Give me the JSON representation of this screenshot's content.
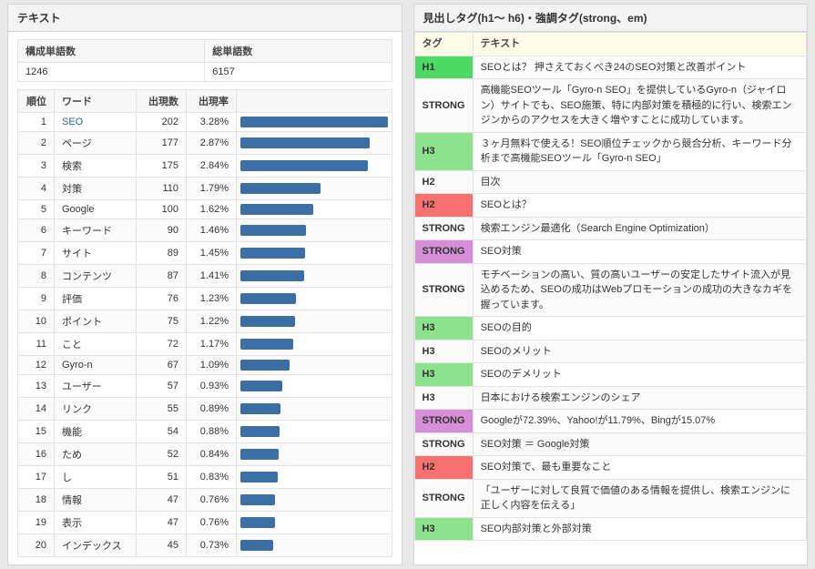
{
  "left": {
    "title": "テキスト",
    "summary": {
      "col1_h": "構成単語数",
      "col2_h": "総単語数",
      "col1_v": "1246",
      "col2_v": "6157"
    },
    "word_headers": {
      "rank": "順位",
      "word": "ワード",
      "count": "出現数",
      "rate": "出現率",
      "bar": ""
    },
    "max_count": 202,
    "words": [
      {
        "rank": 1,
        "word": "SEO",
        "count": 202,
        "rate": "3.28%",
        "link": true
      },
      {
        "rank": 2,
        "word": "ページ",
        "count": 177,
        "rate": "2.87%",
        "link": false
      },
      {
        "rank": 3,
        "word": "検索",
        "count": 175,
        "rate": "2.84%",
        "link": false
      },
      {
        "rank": 4,
        "word": "対策",
        "count": 110,
        "rate": "1.79%",
        "link": false
      },
      {
        "rank": 5,
        "word": "Google",
        "count": 100,
        "rate": "1.62%",
        "link": false
      },
      {
        "rank": 6,
        "word": "キーワード",
        "count": 90,
        "rate": "1.46%",
        "link": false
      },
      {
        "rank": 7,
        "word": "サイト",
        "count": 89,
        "rate": "1.45%",
        "link": false
      },
      {
        "rank": 8,
        "word": "コンテンツ",
        "count": 87,
        "rate": "1.41%",
        "link": false
      },
      {
        "rank": 9,
        "word": "評価",
        "count": 76,
        "rate": "1.23%",
        "link": false
      },
      {
        "rank": 10,
        "word": "ポイント",
        "count": 75,
        "rate": "1.22%",
        "link": false
      },
      {
        "rank": 11,
        "word": "こと",
        "count": 72,
        "rate": "1.17%",
        "link": false
      },
      {
        "rank": 12,
        "word": "Gyro-n",
        "count": 67,
        "rate": "1.09%",
        "link": false
      },
      {
        "rank": 13,
        "word": "ユーザー",
        "count": 57,
        "rate": "0.93%",
        "link": false
      },
      {
        "rank": 14,
        "word": "リンク",
        "count": 55,
        "rate": "0.89%",
        "link": false
      },
      {
        "rank": 15,
        "word": "機能",
        "count": 54,
        "rate": "0.88%",
        "link": false
      },
      {
        "rank": 16,
        "word": "ため",
        "count": 52,
        "rate": "0.84%",
        "link": false
      },
      {
        "rank": 17,
        "word": "し",
        "count": 51,
        "rate": "0.83%",
        "link": false
      },
      {
        "rank": 18,
        "word": "情報",
        "count": 47,
        "rate": "0.76%",
        "link": false
      },
      {
        "rank": 19,
        "word": "表示",
        "count": 47,
        "rate": "0.76%",
        "link": false
      },
      {
        "rank": 20,
        "word": "インデックス",
        "count": 45,
        "rate": "0.73%",
        "link": false
      }
    ]
  },
  "right": {
    "title": "見出しタグ(h1～ h6)・強調タグ(strong、em)",
    "headers": {
      "tag": "タグ",
      "text": "テキスト"
    },
    "rows": [
      {
        "tag": "H1",
        "text": "SEOとは？ 押さえておくべき24のSEO対策と改善ポイント"
      },
      {
        "tag": "STRONG",
        "text": "高機能SEOツール「Gyro-n SEO」を提供しているGyro-n（ジャイロン）サイトでも、SEO施策、特に内部対策を積極的に行い、検索エンジンからのアクセスを大きく増やすことに成功しています。"
      },
      {
        "tag": "H3",
        "text": "３ヶ月無料で使える！SEO順位チェックから競合分析、キーワード分析まで高機能SEOツール「Gyro-n SEO」"
      },
      {
        "tag": "H2",
        "text": "目次"
      },
      {
        "tag": "H2",
        "text": "SEOとは？"
      },
      {
        "tag": "STRONG",
        "text": "検索エンジン最適化（Search Engine Optimization）"
      },
      {
        "tag": "STRONG",
        "text": "SEO対策"
      },
      {
        "tag": "STRONG",
        "text": "モチベーションの高い、質の高いユーザーの安定したサイト流入が見込めるため、SEOの成功はWebプロモーションの成功の大きなカギを握っています。"
      },
      {
        "tag": "H3",
        "text": "SEOの目的"
      },
      {
        "tag": "H3",
        "text": "SEOのメリット"
      },
      {
        "tag": "H3",
        "text": "SEOのデメリット"
      },
      {
        "tag": "H3",
        "text": "日本における検索エンジンのシェア"
      },
      {
        "tag": "STRONG",
        "text": "Googleが72.39%、Yahoo!が11.79%、Bingが15.07%"
      },
      {
        "tag": "STRONG",
        "text": "SEO対策 ＝ Google対策"
      },
      {
        "tag": "H2",
        "text": "SEO対策で、最も重要なこと"
      },
      {
        "tag": "STRONG",
        "text": "「ユーザーに対して良質で価値のある情報を提供し、検索エンジンに正しく内容を伝える」"
      },
      {
        "tag": "H3",
        "text": "SEO内部対策と外部対策"
      }
    ]
  },
  "chart_data": {
    "type": "bar",
    "categories": [
      "SEO",
      "ページ",
      "検索",
      "対策",
      "Google",
      "キーワード",
      "サイト",
      "コンテンツ",
      "評価",
      "ポイント",
      "こと",
      "Gyro-n",
      "ユーザー",
      "リンク",
      "機能",
      "ため",
      "し",
      "情報",
      "表示",
      "インデックス"
    ],
    "values": [
      202,
      177,
      175,
      110,
      100,
      90,
      89,
      87,
      76,
      75,
      72,
      67,
      57,
      55,
      54,
      52,
      51,
      47,
      47,
      45
    ],
    "title": "ワード出現数",
    "xlabel": "",
    "ylabel": "出現数",
    "ylim": [
      0,
      202
    ]
  }
}
